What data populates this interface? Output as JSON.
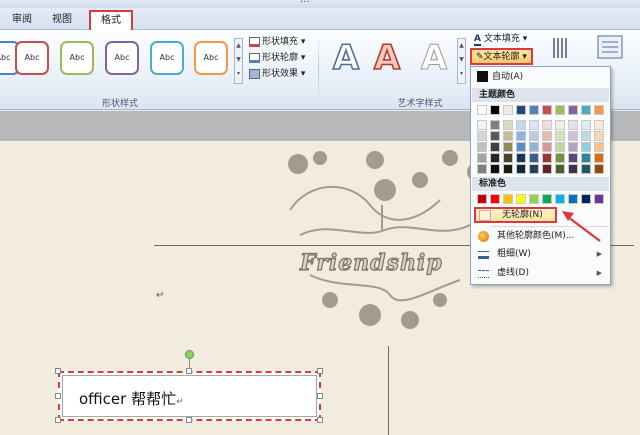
{
  "window": {
    "title": "..."
  },
  "tabs": [
    {
      "label": "审阅"
    },
    {
      "label": "视图"
    },
    {
      "label": "格式"
    }
  ],
  "ribbon": {
    "shape_styles": {
      "group_label": "形状样式",
      "style_sample": "Abc",
      "styles": [
        {
          "border": "#4f81bd"
        },
        {
          "border": "#c0504d"
        },
        {
          "border": "#9bbb59"
        },
        {
          "border": "#8064a2"
        },
        {
          "border": "#4bacc6"
        },
        {
          "border": "#f79646"
        }
      ],
      "shape_fill": "形状填充",
      "shape_outline": "形状轮廓",
      "shape_effects": "形状效果"
    },
    "wordart_styles": {
      "group_label": "艺术字样式",
      "letter": "A",
      "text_fill": "文本填充",
      "text_outline": "文本轮廓"
    }
  },
  "document": {
    "decor_text": "Friendship",
    "paragraph_mark": "↵",
    "textbox_text": "officer 帮帮忙"
  },
  "outline_menu": {
    "auto": "自动(A)",
    "theme_colors_header": "主题颜色",
    "theme_colors": [
      [
        "#ffffff",
        "#000000",
        "#eeece1",
        "#1f497d",
        "#4f81bd",
        "#c0504d",
        "#9bbb59",
        "#8064a2",
        "#4bacc6",
        "#f79646"
      ],
      [
        "#f2f2f2",
        "#7f7f7f",
        "#ddd9c3",
        "#c6d9f0",
        "#dbe5f1",
        "#f2dcdb",
        "#ebf1dd",
        "#e5e0ec",
        "#dbeef3",
        "#fdeada"
      ],
      [
        "#d8d8d8",
        "#595959",
        "#c4bd97",
        "#8db3e2",
        "#b8cce4",
        "#e5b9b7",
        "#d7e3bc",
        "#ccc1d9",
        "#b7dde8",
        "#fbd5b5"
      ],
      [
        "#bfbfbf",
        "#3f3f3f",
        "#938953",
        "#548dd4",
        "#95b3d7",
        "#d99694",
        "#c3d69b",
        "#b2a2c7",
        "#92cddc",
        "#fac08f"
      ],
      [
        "#a5a5a5",
        "#262626",
        "#494429",
        "#17365d",
        "#366092",
        "#953734",
        "#76923c",
        "#5f497a",
        "#31859b",
        "#e36c09"
      ],
      [
        "#7f7f7f",
        "#0c0c0c",
        "#1d1b10",
        "#0f243e",
        "#244061",
        "#632423",
        "#4f6128",
        "#3f3151",
        "#205867",
        "#974806"
      ]
    ],
    "standard_colors_header": "标准色",
    "standard_colors": [
      "#c00000",
      "#ff0000",
      "#ffc000",
      "#ffff00",
      "#92d050",
      "#00b050",
      "#00b0f0",
      "#0070c0",
      "#002060",
      "#7030a0"
    ],
    "no_outline": "无轮廓(N)",
    "more_colors": "其他轮廓颜色(M)...",
    "weight": "粗细(W)",
    "dashes": "虚线(D)"
  },
  "accent_color": "#e0373a"
}
